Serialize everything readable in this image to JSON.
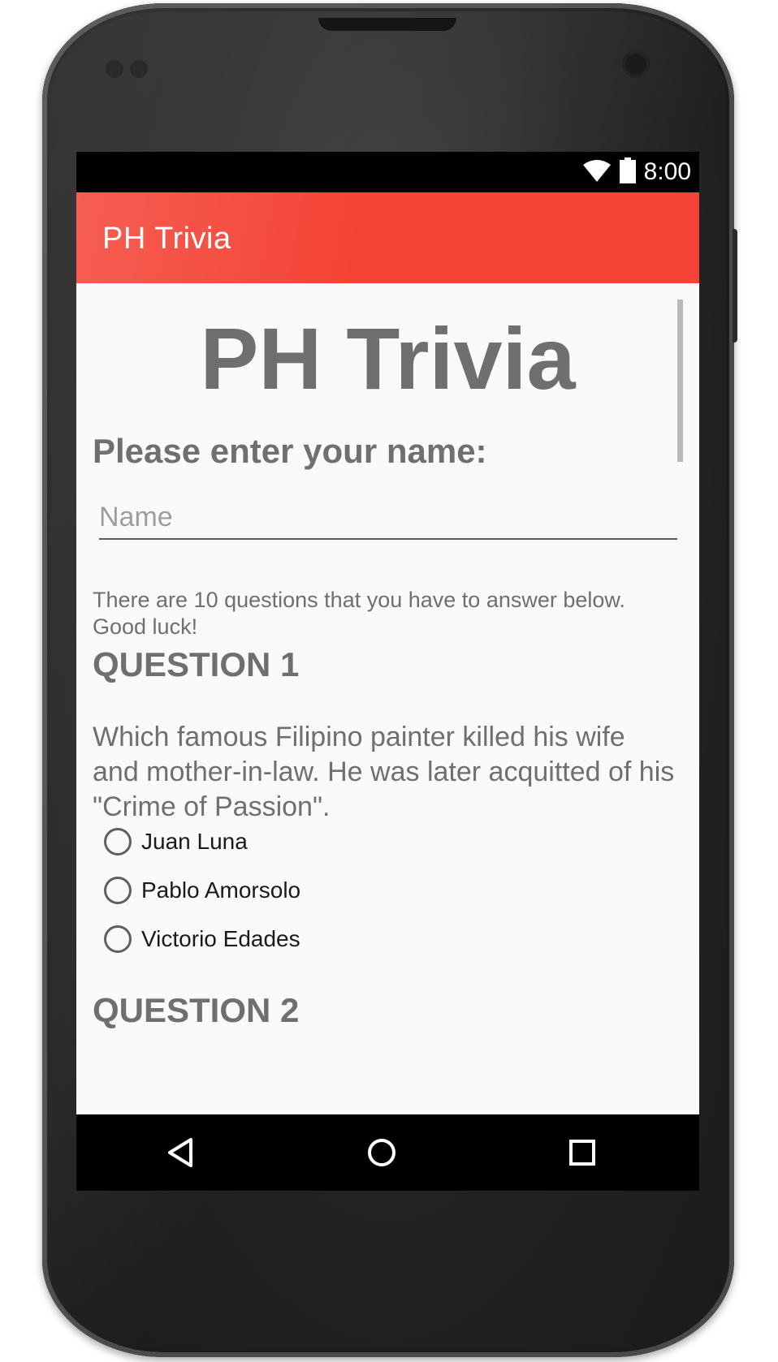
{
  "status_bar": {
    "time": "8:00",
    "icons": [
      "wifi-icon",
      "battery-icon"
    ]
  },
  "app_bar": {
    "title": "PH Trivia"
  },
  "main": {
    "title": "PH Trivia",
    "name_prompt": "Please enter your name:",
    "name_input": {
      "value": "",
      "placeholder": "Name"
    },
    "intro": "There are 10 questions that you have to answer below. Good luck!",
    "questions": [
      {
        "heading": "QUESTION 1",
        "text": "Which famous Filipino painter killed his wife and mother-in-law. He was later acquitted of his \"Crime of Passion\".",
        "options": [
          "Juan Luna",
          "Pablo Amorsolo",
          "Victorio Edades"
        ]
      },
      {
        "heading": "QUESTION 2"
      }
    ]
  },
  "nav_bar": {
    "icons": [
      "back-icon",
      "home-icon",
      "recents-icon"
    ]
  },
  "colors": {
    "accent": "#f44336",
    "text_gray": "#6f6f6f",
    "background": "#fafafa"
  }
}
